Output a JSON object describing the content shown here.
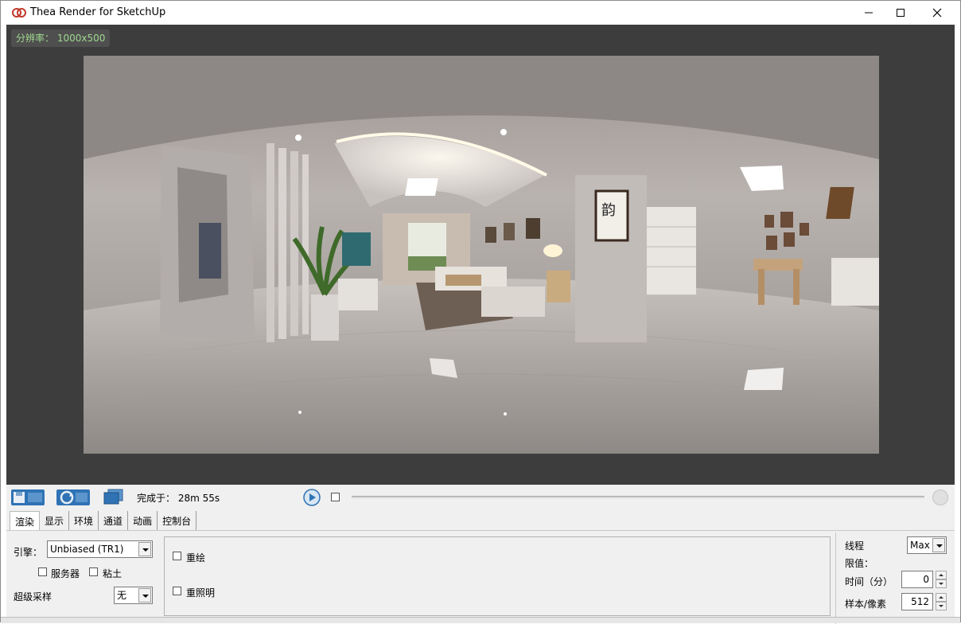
{
  "window": {
    "title": "Thea Render for SketchUp"
  },
  "viewport": {
    "resolution_label": "分辨率：",
    "resolution_value": "1000x500"
  },
  "toolbar": {
    "status_label": "完成于：",
    "status_time": "28m 55s"
  },
  "tabs": [
    "渲染",
    "显示",
    "环境",
    "通道",
    "动画",
    "控制台"
  ],
  "render_tab": {
    "engine_label": "引擎：",
    "engine_value": "Unbiased (TR1)",
    "server_label": "服务器",
    "clay_label": "粘土",
    "supersampling_label": "超级采样",
    "supersampling_value": "无",
    "redraw_label": "重绘",
    "relight_label": "重照明",
    "threads_label": "线程",
    "threads_value": "Max",
    "limits_label": "限值：",
    "time_label": "时间（分）",
    "time_value": "0",
    "samples_label": "样本/像素",
    "samples_value": "512"
  },
  "colors": {
    "accent_text": "#9fd98f",
    "viewport_bg": "#3d3d3d"
  }
}
